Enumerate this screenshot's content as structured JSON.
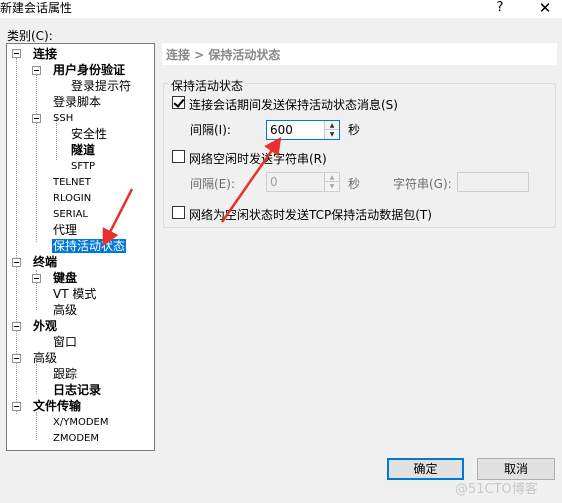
{
  "window": {
    "title": "新建会话属性",
    "help": "?",
    "close": "✕"
  },
  "category_label": "类别(C):",
  "tree": {
    "connection": "连接",
    "user_auth": "用户身份验证",
    "login_prompt": "登录提示符",
    "login_script": "登录脚本",
    "ssh": "SSH",
    "security": "安全性",
    "tunnel": "隧道",
    "sftp": "SFTP",
    "telnet": "TELNET",
    "rlogin": "RLOGIN",
    "serial": "SERIAL",
    "proxy": "代理",
    "keepalive": "保持活动状态",
    "terminal": "终端",
    "keyboard": "键盘",
    "vt_mode": "VT 模式",
    "advanced_term": "高级",
    "appearance": "外观",
    "window_item": "窗口",
    "advanced": "高级",
    "trace": "跟踪",
    "logging": "日志记录",
    "file_transfer": "文件传输",
    "xymodem": "X/YMODEM",
    "zmodem": "ZMODEM"
  },
  "header": "连接 > 保持活动状态",
  "group": {
    "title": "保持活动状态",
    "send_keepalive": {
      "label": "连接会话期间发送保持活动状态消息(S)",
      "checked": true
    },
    "interval1": {
      "label": "间隔(I):",
      "value": "600",
      "unit": "秒"
    },
    "send_string": {
      "label": "网络空闲时发送字符串(R)",
      "checked": false
    },
    "interval2": {
      "label": "间隔(E):",
      "value": "0",
      "unit": "秒"
    },
    "string_label": "字符串(G):",
    "string_value": "",
    "send_tcp": {
      "label": "网络为空闲状态时发送TCP保持活动数据包(T)",
      "checked": false
    }
  },
  "buttons": {
    "ok": "确定",
    "cancel": "取消"
  },
  "watermark": "@51CTO博客",
  "colors": {
    "selection": "#0078d7",
    "arrow": "#e8312e"
  }
}
